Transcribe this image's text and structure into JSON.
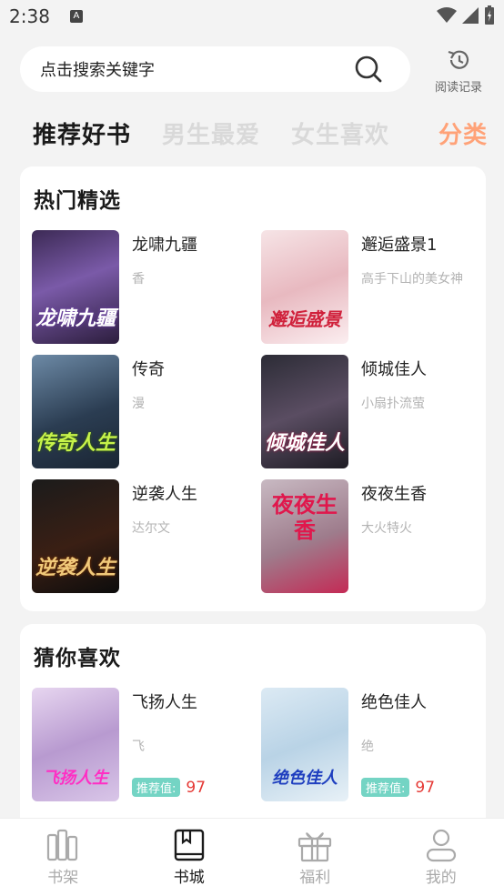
{
  "status_bar": {
    "time": "2:38",
    "sim_letter": "A"
  },
  "search": {
    "placeholder": "点击搜索关键字",
    "history_label": "阅读记录"
  },
  "tabs": [
    {
      "label": "推荐好书"
    },
    {
      "label": "男生最爱"
    },
    {
      "label": "女生喜欢"
    },
    {
      "label": "分类"
    }
  ],
  "hot": {
    "title": "热门精选",
    "books": [
      {
        "title": "龙啸九疆",
        "author": "香",
        "cover_text": "龙啸九疆"
      },
      {
        "title": "邂逅盛景1",
        "author": "高手下山的美女神",
        "cover_text": "邂逅盛景"
      },
      {
        "title": "传奇",
        "author": "漫",
        "cover_text": "传奇人生"
      },
      {
        "title": "倾城佳人",
        "author": "小扇扑流萤",
        "cover_text": "倾城佳人"
      },
      {
        "title": "逆袭人生",
        "author": "达尔文",
        "cover_text": "逆袭人生"
      },
      {
        "title": "夜夜生香",
        "author": "大火特火",
        "cover_text": "夜夜生香"
      }
    ]
  },
  "guess": {
    "title": "猜你喜欢",
    "books": [
      {
        "title": "飞扬人生",
        "author": "飞",
        "cover_text": "飞扬人生",
        "rec_label": "推荐值:",
        "rec_value": "97"
      },
      {
        "title": "绝色佳人",
        "author": "绝",
        "cover_text": "绝色佳人",
        "rec_label": "推荐值:",
        "rec_value": "97"
      }
    ]
  },
  "bottom_nav": [
    {
      "label": "书架",
      "icon": "bookshelf-icon"
    },
    {
      "label": "书城",
      "icon": "book-icon"
    },
    {
      "label": "福利",
      "icon": "gift-icon"
    },
    {
      "label": "我的",
      "icon": "user-icon"
    }
  ]
}
